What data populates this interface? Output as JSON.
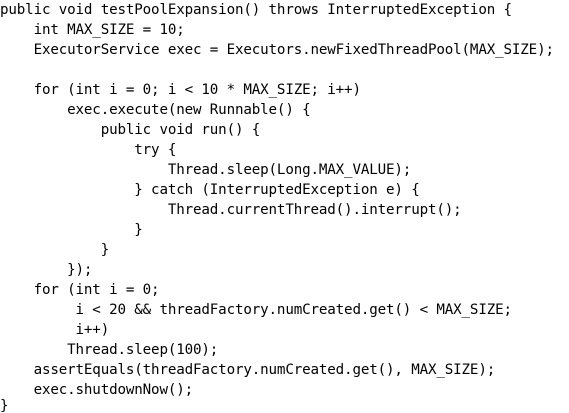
{
  "code": {
    "lines": [
      "public void testPoolExpansion() throws InterruptedException {",
      "    int MAX_SIZE = 10;",
      "    ExecutorService exec = Executors.newFixedThreadPool(MAX_SIZE);",
      "",
      "    for (int i = 0; i < 10 * MAX_SIZE; i++)",
      "        exec.execute(new Runnable() {",
      "            public void run() {",
      "                try {",
      "                    Thread.sleep(Long.MAX_VALUE);",
      "                } catch (InterruptedException e) {",
      "                    Thread.currentThread().interrupt();",
      "                }",
      "            }",
      "        });",
      "    for (int i = 0;",
      "         i < 20 && threadFactory.numCreated.get() < MAX_SIZE;",
      "         i++)",
      "        Thread.sleep(100);",
      "    assertEquals(threadFactory.numCreated.get(), MAX_SIZE);",
      "    exec.shutdownNow();",
      "}"
    ]
  }
}
